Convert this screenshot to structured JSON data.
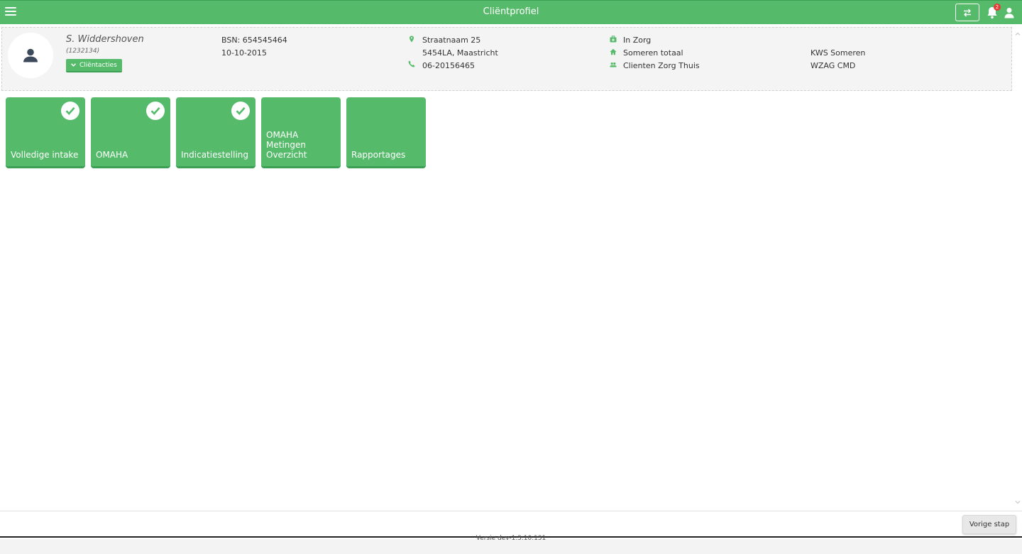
{
  "header": {
    "title": "Cliëntprofiel",
    "notification_count": "2",
    "accent_color": "#55bb6a"
  },
  "client": {
    "name": "S. Widdershoven",
    "id": "(1232134)",
    "actions_label": "Cliëntacties",
    "bsn": "BSN: 654545464",
    "birthdate": "10-10-2015",
    "street": "Straatnaam 25",
    "postal_city": "5454LA, Maastricht",
    "phone": "06-20156465",
    "status": "In Zorg",
    "team": "Someren totaal",
    "group": "Clienten Zorg Thuis",
    "org1": "KWS Someren",
    "org2": "WZAG CMD"
  },
  "tiles": [
    {
      "label": "Volledige intake",
      "completed": true
    },
    {
      "label": "OMAHA",
      "completed": true
    },
    {
      "label": "Indicatiestelling",
      "completed": true
    },
    {
      "label": "OMAHA Metingen Overzicht",
      "completed": false
    },
    {
      "label": "Rapportages",
      "completed": false
    }
  ],
  "footer": {
    "prev_label": "Vorige stap",
    "version": "Versie dev-1.3.10.131"
  }
}
